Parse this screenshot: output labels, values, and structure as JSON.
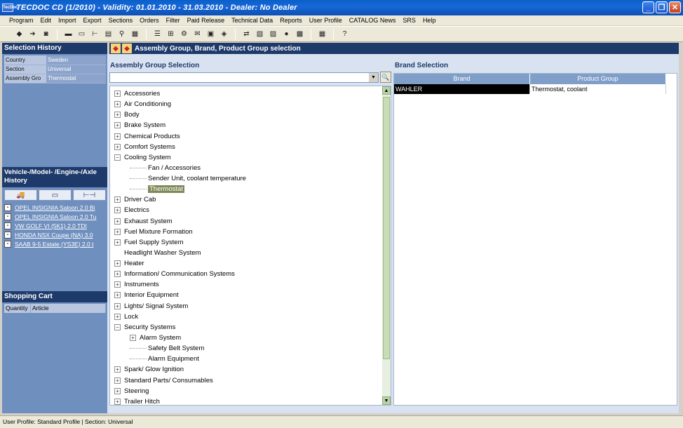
{
  "window": {
    "title": "TECDOC CD (1/2010) - Validity: 01.01.2010 - 31.03.2010 - Dealer: No Dealer",
    "app_icon_text": "TecDoc"
  },
  "menu": [
    "Program",
    "Edit",
    "Import",
    "Export",
    "Sections",
    "Orders",
    "Filter",
    "Paid Release",
    "Technical Data",
    "Reports",
    "User Profile",
    "CATALOG News",
    "SRS",
    "Help"
  ],
  "toolbar_icons": [
    "diamond-icon",
    "vehicle-icon",
    "search-vehicle-icon",
    "sep",
    "truck-icon",
    "box-icon",
    "axle-icon",
    "engine-icon",
    "zoom-icon",
    "parts-icon",
    "sep",
    "list-icon",
    "cart-icon",
    "settings-icon",
    "mail-icon",
    "document-icon",
    "folder-icon",
    "sep",
    "transfer-icon",
    "chart-icon",
    "image-icon",
    "brand-icon",
    "grid-icon",
    "sep",
    "news-icon",
    "sep",
    "help-icon"
  ],
  "selection_history": {
    "title": "Selection History",
    "rows": [
      {
        "key": "Country",
        "value": "Sweden"
      },
      {
        "key": "Section",
        "value": "Universal"
      },
      {
        "key": "Assembly Gro",
        "value": "Thermostat"
      }
    ]
  },
  "vehicle_history": {
    "title": "Vehicle-/Model- /Engine-/Axle History",
    "tabs": [
      "truck-icon",
      "engine-icon",
      "axle-icon"
    ],
    "items": [
      "OPEL INSIGNIA Saloon 2.0 Bi",
      "OPEL INSIGNIA Saloon 2.0 Tu",
      "VW GOLF VI (5K1) 2.0 TDI",
      "HONDA NSX Coupe (NA) 3.0",
      "SAAB 9-5 Estate (YS3E) 2.0 t"
    ]
  },
  "shopping_cart": {
    "title": "Shopping Cart",
    "columns": [
      "Quantity",
      "Article"
    ]
  },
  "main": {
    "title": "Assembly Group, Brand, Product Group selection",
    "assembly_label": "Assembly Group Selection",
    "brand_label": "Brand Selection",
    "combo_value": ""
  },
  "tree": [
    {
      "label": "Accessories",
      "level": 0,
      "exp": "+"
    },
    {
      "label": "Air Conditioning",
      "level": 0,
      "exp": "+"
    },
    {
      "label": "Body",
      "level": 0,
      "exp": "+"
    },
    {
      "label": "Brake System",
      "level": 0,
      "exp": "+"
    },
    {
      "label": "Chemical Products",
      "level": 0,
      "exp": "+"
    },
    {
      "label": "Comfort Systems",
      "level": 0,
      "exp": "+"
    },
    {
      "label": "Cooling System",
      "level": 0,
      "exp": "-"
    },
    {
      "label": "Fan / Accessories",
      "level": 1,
      "exp": ""
    },
    {
      "label": "Sender Unit, coolant temperature",
      "level": 1,
      "exp": ""
    },
    {
      "label": "Thermostat",
      "level": 1,
      "exp": "",
      "selected": true
    },
    {
      "label": "Driver Cab",
      "level": 0,
      "exp": "+"
    },
    {
      "label": "Electrics",
      "level": 0,
      "exp": "+"
    },
    {
      "label": "Exhaust System",
      "level": 0,
      "exp": "+"
    },
    {
      "label": "Fuel Mixture Formation",
      "level": 0,
      "exp": "+"
    },
    {
      "label": "Fuel Supply System",
      "level": 0,
      "exp": "+"
    },
    {
      "label": "Headlight Washer System",
      "level": 0,
      "exp": ""
    },
    {
      "label": "Heater",
      "level": 0,
      "exp": "+"
    },
    {
      "label": "Information/ Communication Systems",
      "level": 0,
      "exp": "+"
    },
    {
      "label": "Instruments",
      "level": 0,
      "exp": "+"
    },
    {
      "label": "Interior Equipment",
      "level": 0,
      "exp": "+"
    },
    {
      "label": "Lights/ Signal System",
      "level": 0,
      "exp": "+"
    },
    {
      "label": "Lock",
      "level": 0,
      "exp": "+"
    },
    {
      "label": "Security Systems",
      "level": 0,
      "exp": "-"
    },
    {
      "label": "Alarm System",
      "level": 1,
      "exp": "+"
    },
    {
      "label": "Safety Belt System",
      "level": 1,
      "exp": ""
    },
    {
      "label": "Alarm Equipment",
      "level": 1,
      "exp": ""
    },
    {
      "label": "Spark/ Glow Ignition",
      "level": 0,
      "exp": "+"
    },
    {
      "label": "Standard Parts/ Consumables",
      "level": 0,
      "exp": "+"
    },
    {
      "label": "Steering",
      "level": 0,
      "exp": "+"
    },
    {
      "label": "Trailer Hitch",
      "level": 0,
      "exp": "+"
    }
  ],
  "brand_grid": {
    "columns": [
      "Brand",
      "Product Group"
    ],
    "rows": [
      {
        "brand": "WAHLER",
        "product_group": "Thermostat, coolant"
      }
    ]
  },
  "status": "User Profile: Standard Profile | Section: Universal"
}
